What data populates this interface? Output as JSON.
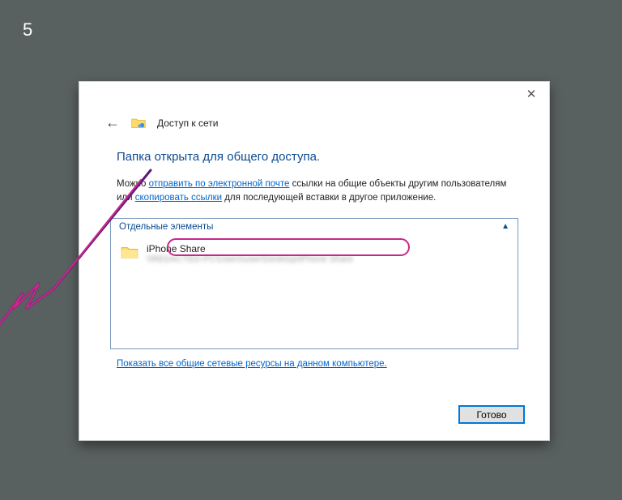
{
  "page_number": "5",
  "dialog": {
    "title": "Доступ к сети",
    "heading": "Папка открыта для общего доступа.",
    "description": {
      "prefix": "Можно ",
      "link_email": "отправить по электронной почте",
      "mid": " ссылки на общие объекты другим пользователям или ",
      "link_copy": "скопировать ссылки",
      "suffix": " для последующей вставки в другое приложение."
    },
    "groupbox_label": "Отдельные элементы",
    "item": {
      "name": "iPhone Share",
      "path": "\\\\REDACTED-PC\\Users\\user\\Desktop\\iPhone Share"
    },
    "footer_link": "Показать все общие сетевые ресурсы на данном компьютере.",
    "done_button": "Готово"
  }
}
